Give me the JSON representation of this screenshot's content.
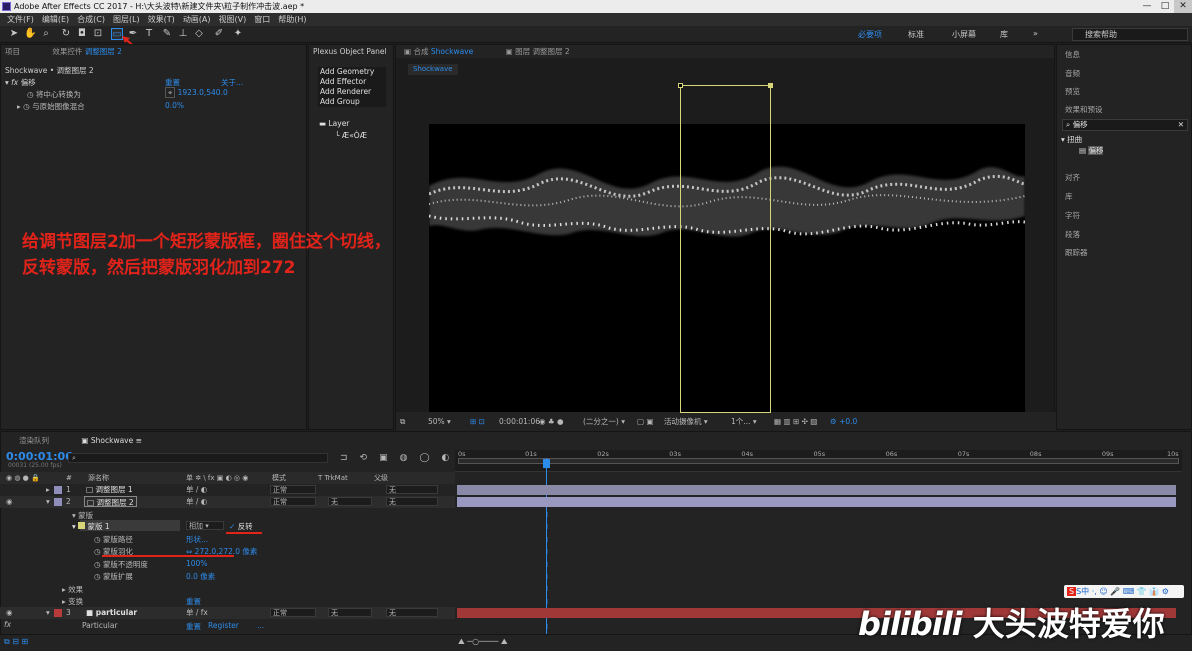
{
  "window": {
    "title": "Adobe After Effects CC 2017 - H:\\大头波特\\新建文件夹\\粒子制作冲击波.aep *",
    "controls": [
      "—",
      "□",
      "✕"
    ]
  },
  "menu": [
    "文件(F)",
    "编辑(E)",
    "合成(C)",
    "图层(L)",
    "效果(T)",
    "动画(A)",
    "视图(V)",
    "窗口",
    "帮助(H)"
  ],
  "toolbar": {
    "workspaces": [
      "必要项",
      "标准",
      "小屏幕",
      "库"
    ],
    "active_workspace": "必要项",
    "more": "»",
    "search_placeholder": "搜索帮助"
  },
  "effects_panel": {
    "tab_project": "项目",
    "tab_effects_prefix": "效果控件",
    "tab_effects_layer": "调整图层 2",
    "breadcrumb": "Shockwave • 调整图层 2",
    "effect_name": "偏移",
    "reset": "重置",
    "about": "关于...",
    "prop1_label": "将中心转换为",
    "prop1_value": "1923.0,540.0",
    "prop2_label": "与原始图像混合",
    "prop2_value": "0.0%"
  },
  "plexus": {
    "title": "Plexus Object Panel",
    "items": [
      "Add Geometry",
      "Add Effector",
      "Add Renderer",
      "Add Group"
    ],
    "tree_root": "Layer",
    "tree_child": "Æ«ÒÆ"
  },
  "comp_viewer": {
    "tab_prefix": "合成",
    "tab_name": "Shockwave",
    "tab2": "图层 调整图层 2",
    "sub_tab": "Shockwave",
    "zoom": "50%",
    "timecode": "0:00:01:06",
    "resolution": "(二分之一)",
    "camera": "活动摄像机",
    "views": "1个...",
    "exposure": "+0.0"
  },
  "annotation": {
    "line1": "给调节图层2加一个矩形蒙版框，圈住这个切线，",
    "line2": "反转蒙版，然后把蒙版羽化加到272"
  },
  "right_panel": {
    "items": [
      "信息",
      "音频",
      "预览",
      "效果和预设"
    ],
    "search_value": "偏移",
    "group": "扭曲",
    "result": "偏移",
    "items2": [
      "对齐",
      "库",
      "字符",
      "段落",
      "跟踪器"
    ]
  },
  "timeline": {
    "tab_render": "渲染队列",
    "tab_comp": "Shockwave",
    "timecode": "0:00:01:06",
    "fps": "00031 (25.00 fps)",
    "headers": {
      "name": "源名称",
      "switches": "单 ✲ \\ fx ▣ ◐ ◎ ◉",
      "mode": "模式",
      "trkmat": "T TrkMat",
      "parent": "父级"
    },
    "ruler": [
      "0s",
      "01s",
      "02s",
      "03s",
      "04s",
      "05s",
      "06s",
      "07s",
      "08s",
      "09s",
      "10s"
    ],
    "layers": [
      {
        "num": "1",
        "name": "调整图层 1",
        "mode": "正常",
        "trkmat": "",
        "parent": "无"
      },
      {
        "num": "2",
        "name": "调整图层 2",
        "mode": "正常",
        "trkmat": "无",
        "parent": "无"
      },
      {
        "num": "3",
        "name": "particular",
        "mode": "正常",
        "trkmat": "无",
        "parent": "无"
      }
    ],
    "masks_label": "蒙版",
    "mask_name": "蒙版 1",
    "mask_mode": "相加",
    "inverted_label": "反转",
    "mask_props": [
      {
        "label": "蒙版路径",
        "value": "形状..."
      },
      {
        "label": "蒙版羽化",
        "value": "272.0,272.0 像素"
      },
      {
        "label": "蒙版不透明度",
        "value": "100%"
      },
      {
        "label": "蒙版扩展",
        "value": "0.0 像素"
      }
    ],
    "effects_label": "效果",
    "transform_label": "变换",
    "reset": "重置",
    "particular_label": "Particular",
    "register": "Register",
    "ellipsis": "..."
  },
  "watermark": {
    "brand": "bilibili",
    "text": "大头波特爱你"
  },
  "ime": {
    "label": "S中 ·, ☺ 🎤 ⌨ 👕 👔 ⚙"
  },
  "colors": {
    "accent": "#2d8ceb",
    "annotation": "#e2231a",
    "layer_lavender": "#8e8eb8",
    "layer_red": "#b93a3a"
  }
}
